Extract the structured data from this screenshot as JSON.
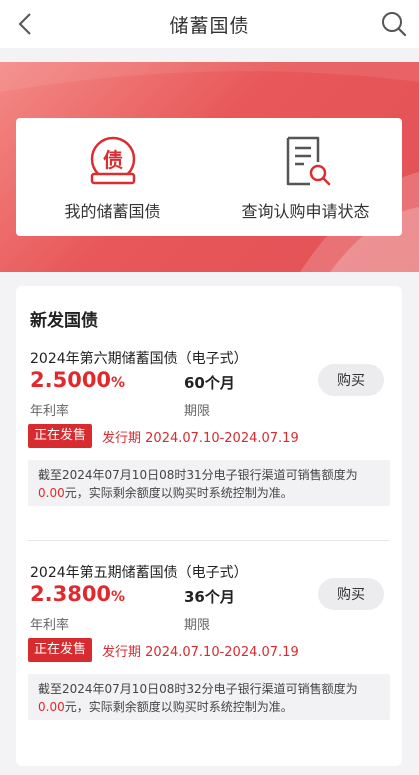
{
  "nav": {
    "title": "储蓄国债"
  },
  "shortcuts": [
    {
      "label": "我的储蓄国债",
      "icon": "bond-certificate-icon"
    },
    {
      "label": "查询认购申请状态",
      "icon": "document-search-icon"
    }
  ],
  "section": {
    "title": "新发国债"
  },
  "bonds": [
    {
      "name": "2024年第六期储蓄国债（电子式）",
      "rate": "2.5000",
      "rate_unit": "%",
      "rate_label": "年利率",
      "term": "60个月",
      "term_label": "期限",
      "buy_label": "购买",
      "status": "正在发售",
      "period_label": "发行期",
      "period": "2024.07.10-2024.07.19",
      "note_prefix": "截至2024年07月10日08时31分电子银行渠道可销售额度为",
      "note_amount": "0.00",
      "note_suffix": "元，实际剩余额度以购买时系统控制为准。"
    },
    {
      "name": "2024年第五期储蓄国债（电子式）",
      "rate": "2.3800",
      "rate_unit": "%",
      "rate_label": "年利率",
      "term": "36个月",
      "term_label": "期限",
      "buy_label": "购买",
      "status": "正在发售",
      "period_label": "发行期",
      "period": "2024.07.10-2024.07.19",
      "note_prefix": "截至2024年07月10日08时32分电子银行渠道可销售额度为",
      "note_amount": "0.00",
      "note_suffix": "元，实际剩余额度以购买时系统控制为准。"
    }
  ],
  "colors": {
    "accent": "#e02a2e",
    "banner": "#e8585a",
    "badge": "#d72b2f"
  }
}
